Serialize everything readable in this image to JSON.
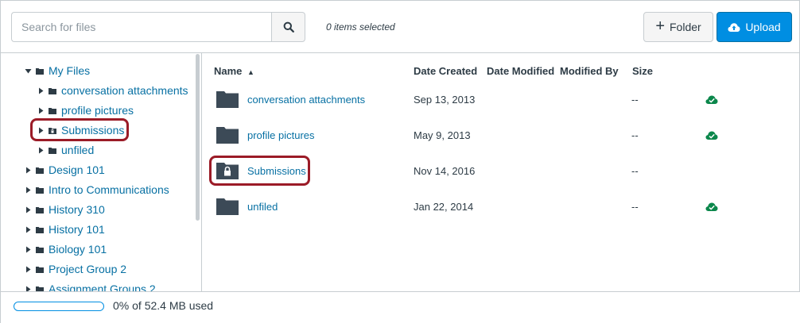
{
  "toolbar": {
    "search_placeholder": "Search for files",
    "search_button_icon": "search-icon",
    "selected_count": "0 items selected",
    "folder_button_label": "Folder",
    "upload_button_label": "Upload",
    "upload_color": "#008ee2"
  },
  "tree": {
    "items": [
      {
        "label": "My Files",
        "expanded": true
      },
      {
        "label": "conversation attachments"
      },
      {
        "label": "profile pictures"
      },
      {
        "label": "Submissions",
        "locked": true
      },
      {
        "label": "unfiled"
      },
      {
        "label": "Design 101"
      },
      {
        "label": "Intro to Communications"
      },
      {
        "label": "History 310"
      },
      {
        "label": "History 101"
      },
      {
        "label": "Biology 101"
      },
      {
        "label": "Project Group 2"
      },
      {
        "label": "Assignment Groups 2"
      }
    ]
  },
  "list": {
    "headers": {
      "name": "Name",
      "sort_indicator": "▲",
      "date_created": "Date Created",
      "date_modified": "Date Modified",
      "modified_by": "Modified By",
      "size": "Size"
    },
    "rows": [
      {
        "name": "conversation attachments",
        "date_created": "Sep 13, 2013",
        "size": "--",
        "published": true,
        "locked": false
      },
      {
        "name": "profile pictures",
        "date_created": "May 9, 2013",
        "size": "--",
        "published": true,
        "locked": false
      },
      {
        "name": "Submissions",
        "date_created": "Nov 14, 2016",
        "size": "--",
        "published": false,
        "locked": true
      },
      {
        "name": "unfiled",
        "date_created": "Jan 22, 2014",
        "size": "--",
        "published": true,
        "locked": false
      }
    ]
  },
  "footer": {
    "quota_text": "0% of 52.4 MB used",
    "quota_fraction": 0
  },
  "colors": {
    "link": "#0770a3",
    "highlight": "#9b1b27",
    "published": "#0b874b"
  }
}
